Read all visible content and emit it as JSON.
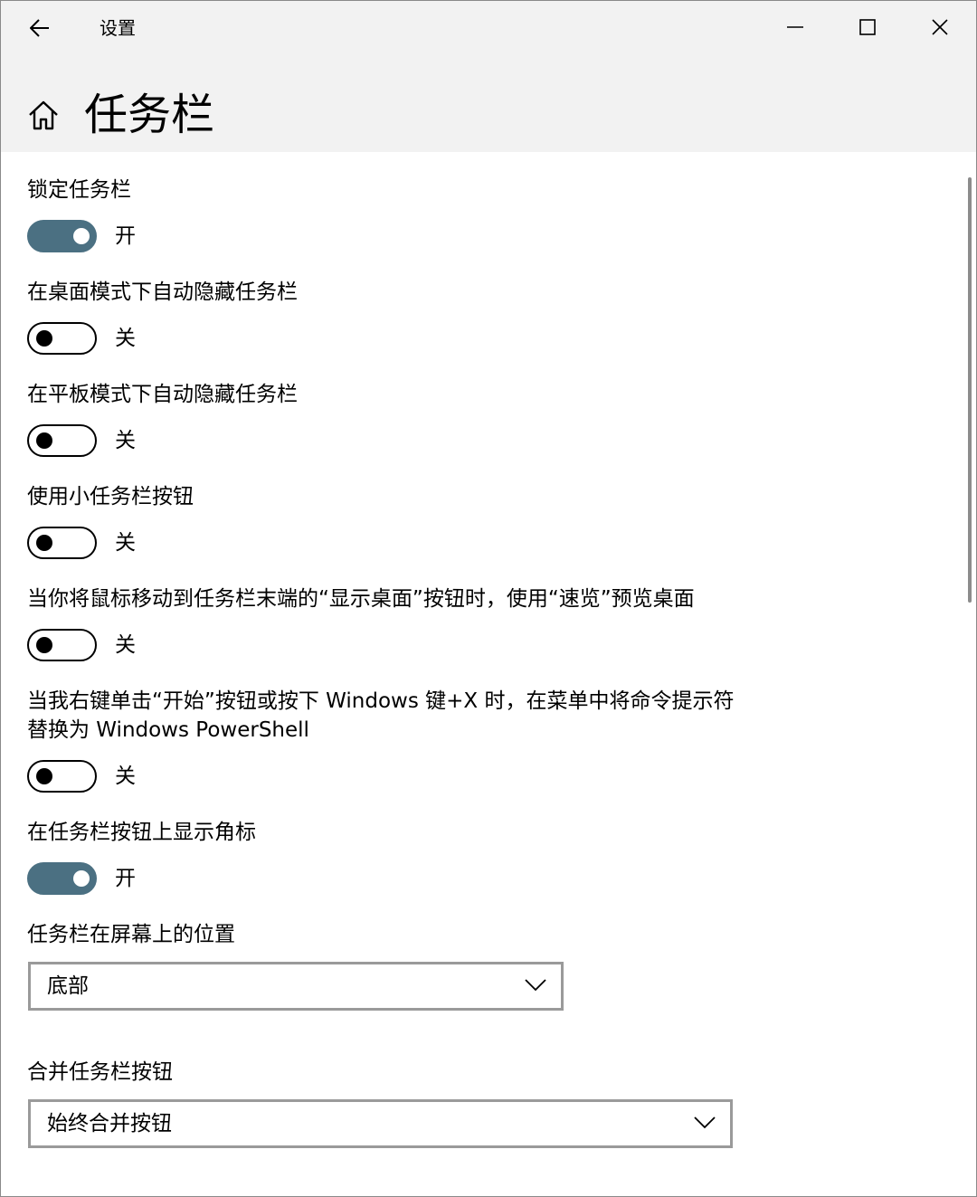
{
  "window": {
    "app_title": "设置",
    "controls": {
      "minimize_icon": "minimize-icon",
      "maximize_icon": "maximize-icon",
      "close_icon": "close-icon"
    }
  },
  "page": {
    "title": "任务栏",
    "home_icon": "home-icon",
    "back_icon": "back-arrow-icon"
  },
  "settings": [
    {
      "label": "锁定任务栏",
      "state": "开",
      "on": true
    },
    {
      "label": "在桌面模式下自动隐藏任务栏",
      "state": "关",
      "on": false
    },
    {
      "label": "在平板模式下自动隐藏任务栏",
      "state": "关",
      "on": false
    },
    {
      "label": "使用小任务栏按钮",
      "state": "关",
      "on": false
    },
    {
      "label": "当你将鼠标移动到任务栏末端的“显示桌面”按钮时，使用“速览”预览桌面",
      "state": "关",
      "on": false
    },
    {
      "label": "当我右键单击“开始”按钮或按下 Windows 键+X 时，在菜单中将命令提示符替换为 Windows PowerShell",
      "state": "关",
      "on": false
    },
    {
      "label": "在任务栏按钮上显示角标",
      "state": "开",
      "on": true
    }
  ],
  "position": {
    "label": "任务栏在屏幕上的位置",
    "selected": "底部"
  },
  "combine": {
    "label": "合并任务栏按钮",
    "selected": "始终合并按钮"
  },
  "colors": {
    "toggle_on": "#4b7082",
    "header_bg": "#f2f2f2",
    "dropdown_border": "#9a9a9a"
  }
}
